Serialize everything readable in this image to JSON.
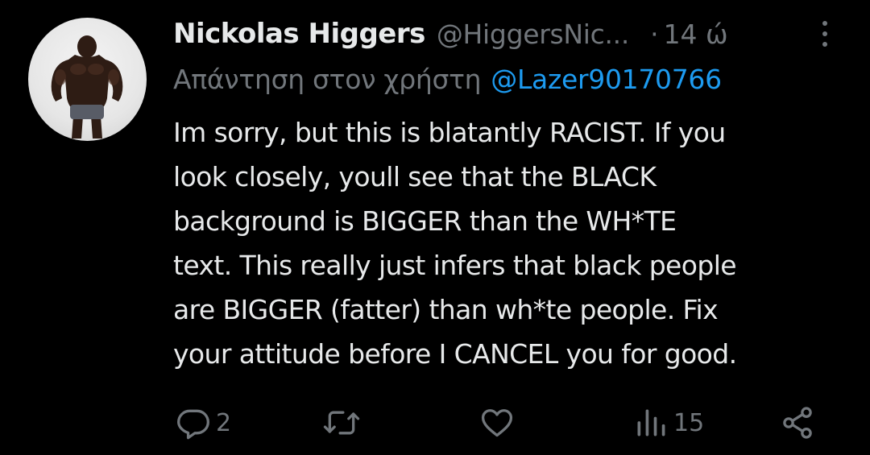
{
  "tweet": {
    "author": {
      "display_name": "Nickolas Higgers",
      "handle": "@HiggersNic...",
      "avatar_icon": "bodybuilder-avatar"
    },
    "separator": "·",
    "time": "14 ώ",
    "reply": {
      "prefix": "Απάντηση στον χρήστη",
      "user": "@Lazer90170766"
    },
    "body_lines": [
      "Im sorry, but this is blatantly RACIST. If you",
      "look closely, youll see that the BLACK",
      "background is BIGGER than the WH*TE",
      "text. This really just infers that black people",
      "are BIGGER (fatter) than wh*te people. Fix",
      "your attitude before I CANCEL you for good."
    ],
    "actions": {
      "reply_count": "2",
      "retweet_count": "",
      "like_count": "",
      "views_count": "15"
    }
  },
  "colors": {
    "background": "#000000",
    "text_primary": "#e7e9ea",
    "text_secondary": "#71767b",
    "link": "#1d9bf0"
  }
}
